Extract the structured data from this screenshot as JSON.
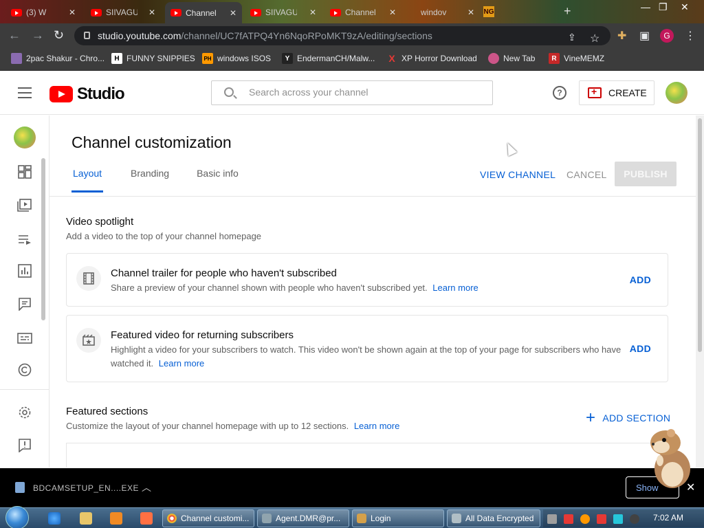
{
  "browser": {
    "tabs": [
      {
        "title": "(3) W",
        "active": false
      },
      {
        "title": "SIIVAGU",
        "active": false
      },
      {
        "title": "Channel",
        "active": true
      },
      {
        "title": "SIIVAGU",
        "active": false
      },
      {
        "title": "Channel",
        "active": false
      },
      {
        "title": "windov",
        "active": false
      }
    ],
    "url_host": "studio.youtube.com",
    "url_path": "/channel/UC7fATPQ4Yn6NqoRPoMKT9zA/editing/sections",
    "profile_initial": "G",
    "bookmarks": [
      {
        "label": "2pac Shakur - Chro...",
        "icon_text": "",
        "icon_color": "#8a6bb0"
      },
      {
        "label": "FUNNY SNIPPIES",
        "icon_text": "H",
        "icon_color": "#ffffff"
      },
      {
        "label": "windows ISOS",
        "icon_text": "PH",
        "icon_color": "#f90"
      },
      {
        "label": "EndermanCH/Malw...",
        "icon_text": "Y",
        "icon_color": "#222"
      },
      {
        "label": "XP Horror Download",
        "icon_text": "X",
        "icon_color": "#3c3c3c"
      },
      {
        "label": "New Tab",
        "icon_text": "",
        "icon_color": "#c58"
      },
      {
        "label": "VineMEMZ",
        "icon_text": "R",
        "icon_color": "#c62828"
      }
    ]
  },
  "header": {
    "logo_text": "Studio",
    "search_placeholder": "Search across your channel",
    "create_label": "CREATE",
    "help_glyph": "?"
  },
  "page": {
    "title": "Channel customization",
    "tabs": [
      "Layout",
      "Branding",
      "Basic info"
    ],
    "actions": {
      "view_channel": "VIEW CHANNEL",
      "cancel": "CANCEL",
      "publish": "PUBLISH"
    }
  },
  "video_spotlight": {
    "title": "Video spotlight",
    "subtitle": "Add a video to the top of your channel homepage",
    "cards": [
      {
        "title": "Channel trailer for people who haven't subscribed",
        "desc": "Share a preview of your channel shown with people who haven't subscribed yet.",
        "link": "Learn more",
        "action": "ADD"
      },
      {
        "title": "Featured video for returning subscribers",
        "desc": "Highlight a video for your subscribers to watch. This video won't be shown again at the top of your page for subscribers who have watched it.",
        "link": "Learn more",
        "action": "ADD"
      }
    ]
  },
  "featured_sections": {
    "title": "Featured sections",
    "subtitle": "Customize the layout of your channel homepage with up to 12 sections.",
    "link": "Learn more",
    "add_label": "ADD SECTION"
  },
  "download_bar": {
    "filename": "BDCAMSETUP_EN....EXE",
    "show_all": "Show"
  },
  "taskbar": {
    "buttons": [
      {
        "label": "Channel customi...",
        "icon_color": "#e53935"
      },
      {
        "label": "Agent.DMR@pr...",
        "icon_color": "#90a4ae"
      },
      {
        "label": "Login",
        "icon_color": "#d4a04a"
      },
      {
        "label": "All Data Encrypted",
        "icon_color": "#b0bec5"
      }
    ],
    "clock": "7:02 AM"
  },
  "colors": {
    "accent": "#065fd4",
    "youtube_red": "#ff0000"
  }
}
